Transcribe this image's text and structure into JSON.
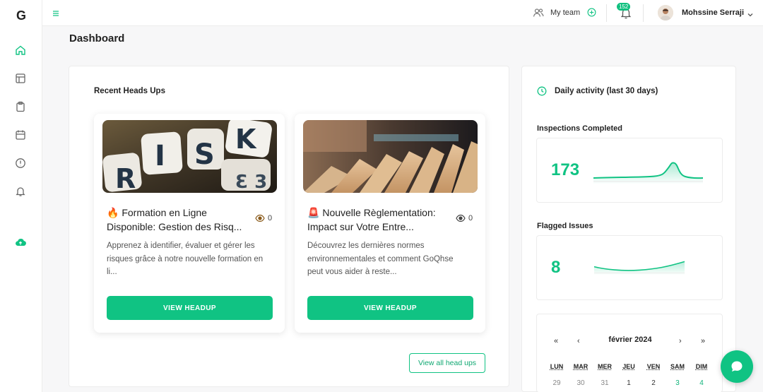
{
  "app": {
    "logo": "G"
  },
  "colors": {
    "accent": "#10c383",
    "text": "#222222"
  },
  "sidebar": {
    "items": [
      {
        "icon": "home-icon",
        "active": true
      },
      {
        "icon": "layout-icon"
      },
      {
        "icon": "clipboard-icon"
      },
      {
        "icon": "calendar-icon"
      },
      {
        "icon": "alert-circle-icon"
      },
      {
        "icon": "bell-icon"
      },
      {
        "icon": "cloud-upload-icon"
      }
    ]
  },
  "topbar": {
    "team_label": "My team",
    "notifications_count": "152",
    "user_name": "Mohssine Serraji"
  },
  "page": {
    "title": "Dashboard"
  },
  "headups": {
    "section_title": "Recent Heads Ups",
    "cards": [
      {
        "emoji": "🔥",
        "title": "Formation en Ligne Disponible: Gestion des Risq...",
        "views": "0",
        "description": "Apprenez à identifier, évaluer et gérer les risques grâce à notre nouvelle formation en li...",
        "button": "VIEW HEADUP",
        "image": "risk-dice-image"
      },
      {
        "emoji": "🚨",
        "title": "Nouvelle Règlementation: Impact sur Votre Entre...",
        "views": "0",
        "description": "Découvrez les dernières normes environnementales et comment GoQhse peut vous aider à reste...",
        "button": "VIEW HEADUP",
        "image": "wooden-blocks-image"
      }
    ],
    "view_all": "View all head ups"
  },
  "activity": {
    "title": "Daily activity (last 30 days)",
    "inspections": {
      "label": "Inspections Completed",
      "value": "173"
    },
    "flagged": {
      "label": "Flagged Issues",
      "value": "8"
    }
  },
  "calendar": {
    "nav_prev_year": "«",
    "nav_prev": "‹",
    "month": "février 2024",
    "nav_next": "›",
    "nav_next_year": "»",
    "weekdays": [
      "LUN",
      "MAR",
      "MER",
      "JEU",
      "VEN",
      "SAM",
      "DIM"
    ],
    "first_row": [
      "29",
      "30",
      "31",
      "1",
      "2",
      "3",
      "4"
    ]
  }
}
